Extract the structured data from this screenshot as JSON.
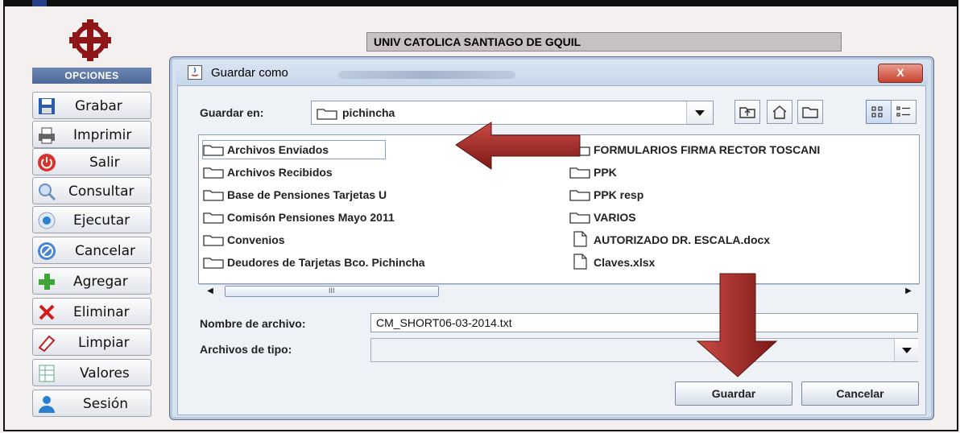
{
  "app": {
    "header_title": "UNIV CATOLICA SANTIAGO DE GQUIL",
    "side_header": "OPCIONES",
    "side_buttons": [
      {
        "label": "Grabar",
        "icon": "floppy-disk-icon"
      },
      {
        "label": "Imprimir",
        "icon": "printer-icon"
      },
      {
        "label": "Salir",
        "icon": "power-icon"
      },
      {
        "label": "Consultar",
        "icon": "magnifier-icon"
      },
      {
        "label": "Ejecutar",
        "icon": "execute-icon"
      },
      {
        "label": "Cancelar",
        "icon": "cancel-icon"
      },
      {
        "label": "Agregar",
        "icon": "plus-icon"
      },
      {
        "label": "Eliminar",
        "icon": "x-icon"
      },
      {
        "label": "Limpiar",
        "icon": "eraser-icon"
      },
      {
        "label": "Valores",
        "icon": "table-icon"
      },
      {
        "label": "Sesión",
        "icon": "user-icon"
      }
    ]
  },
  "dialog": {
    "title": "Guardar como",
    "close_label": "X",
    "save_in_label": "Guardar en:",
    "save_in_value": "pichincha",
    "folders_left": [
      "Archivos Enviados",
      "Archivos Recibidos",
      "Base de Pensiones Tarjetas U",
      "Comisón Pensiones Mayo 2011",
      "Convenios",
      "Deudores de Tarjetas Bco. Pichincha"
    ],
    "items_right": [
      {
        "name": "FORMULARIOS FIRMA RECTOR TOSCANI",
        "kind": "folder"
      },
      {
        "name": "PPK",
        "kind": "folder"
      },
      {
        "name": "PPK resp",
        "kind": "folder"
      },
      {
        "name": "VARIOS",
        "kind": "folder"
      },
      {
        "name": "AUTORIZADO DR. ESCALA.docx",
        "kind": "file"
      },
      {
        "name": "Claves.xlsx",
        "kind": "file"
      }
    ],
    "scroll_mid_label": "III",
    "file_name_label": "Nombre de archivo:",
    "file_name_value": "CM_SHORT06-03-2014.txt",
    "file_type_label": "Archivos de tipo:",
    "file_type_value": "",
    "save_button": "Guardar",
    "cancel_button": "Cancelar"
  },
  "colors": {
    "arrow": "#a52a2a",
    "dialog_bg": "#eef1f5",
    "side_header": "#5a74a3"
  }
}
